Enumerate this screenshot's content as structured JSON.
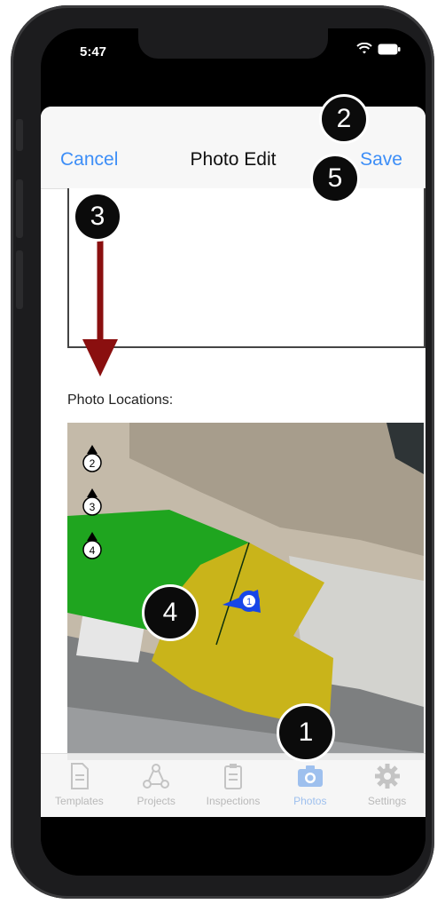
{
  "status": {
    "time": "5:47"
  },
  "navbar": {
    "cancel_label": "Cancel",
    "title": "Photo Edit",
    "save_label": "Save"
  },
  "section": {
    "photo_locations_label": "Photo Locations:"
  },
  "map": {
    "markers": [
      "1",
      "2",
      "3",
      "4"
    ],
    "zone_colors": {
      "green": "#1fa51f",
      "yellow": "#c9b41a",
      "marker_blue": "#1746e8"
    }
  },
  "tabbar": {
    "items": [
      {
        "label": "Templates",
        "icon": "document-icon"
      },
      {
        "label": "Projects",
        "icon": "projects-icon"
      },
      {
        "label": "Inspections",
        "icon": "clipboard-icon"
      },
      {
        "label": "Photos",
        "icon": "camera-icon"
      },
      {
        "label": "Settings",
        "icon": "gear-icon"
      }
    ],
    "active": "Photos"
  },
  "callouts": [
    "1",
    "2",
    "3",
    "4",
    "5"
  ],
  "colors": {
    "accent": "#3d8ef7",
    "arrow": "#8a0f0f",
    "badge": "#0b0b0b"
  }
}
